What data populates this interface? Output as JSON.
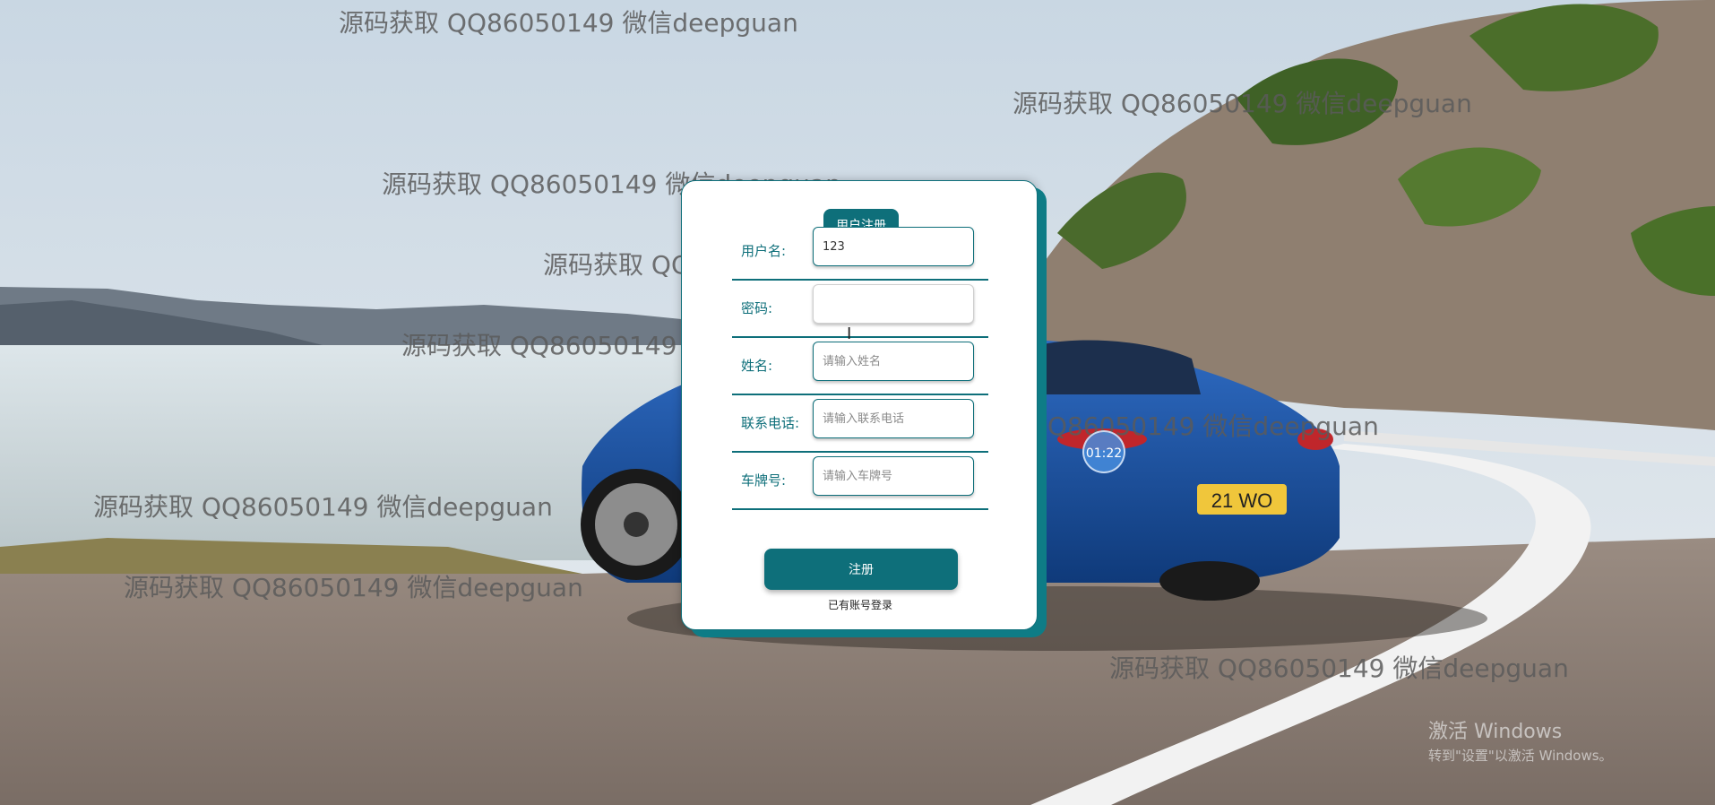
{
  "form": {
    "title": "用户注册",
    "fields": [
      {
        "label": "用户名:",
        "value": "123",
        "placeholder": ""
      },
      {
        "label": "密码:",
        "value": "",
        "placeholder": ""
      },
      {
        "label": "姓名:",
        "value": "",
        "placeholder": "请输入姓名"
      },
      {
        "label": "联系电话:",
        "value": "",
        "placeholder": "请输入联系电话"
      },
      {
        "label": "车牌号:",
        "value": "",
        "placeholder": "请输入车牌号"
      }
    ],
    "submit_label": "注册",
    "login_link": "已有账号登录"
  },
  "watermark_text": "源码获取 QQ86050149 微信deepguan",
  "timer": "01:22",
  "os_notice": {
    "line1": "激活 Windows",
    "line2": "转到\"设置\"以激活 Windows。"
  },
  "colors": {
    "accent": "#0e6f7a",
    "card_bg": "#ffffff"
  }
}
